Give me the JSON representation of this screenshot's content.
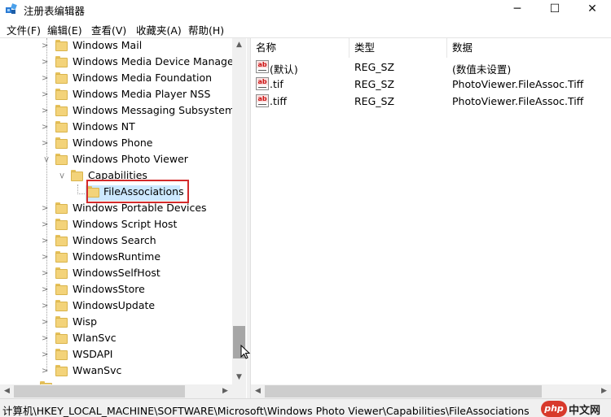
{
  "window": {
    "title": "注册表编辑器",
    "controls": {
      "minimize": "─",
      "maximize": "☐",
      "close": "✕"
    }
  },
  "menu": [
    "文件(F)",
    "编辑(E)",
    "查看(V)",
    "收藏夹(A)",
    "帮助(H)"
  ],
  "tree": {
    "items": [
      {
        "label": "Windows Mail",
        "expanded": false
      },
      {
        "label": "Windows Media Device Manager",
        "expanded": false
      },
      {
        "label": "Windows Media Foundation",
        "expanded": false
      },
      {
        "label": "Windows Media Player NSS",
        "expanded": false
      },
      {
        "label": "Windows Messaging Subsystem",
        "expanded": false
      },
      {
        "label": "Windows NT",
        "expanded": false
      },
      {
        "label": "Windows Phone",
        "expanded": false
      },
      {
        "label": "Windows Photo Viewer",
        "expanded": true
      },
      {
        "label": "Capabilities",
        "expanded": true
      },
      {
        "label": "FileAssociations",
        "selected": true
      },
      {
        "label": "Windows Portable Devices",
        "expanded": false
      },
      {
        "label": "Windows Script Host",
        "expanded": false
      },
      {
        "label": "Windows Search",
        "expanded": false
      },
      {
        "label": "WindowsRuntime",
        "expanded": false
      },
      {
        "label": "WindowsSelfHost",
        "expanded": false
      },
      {
        "label": "WindowsStore",
        "expanded": false
      },
      {
        "label": "WindowsUpdate",
        "expanded": false
      },
      {
        "label": "Wisp",
        "expanded": false
      },
      {
        "label": "WlanSvc",
        "expanded": false
      },
      {
        "label": "WSDAPI",
        "expanded": false
      },
      {
        "label": "WwanSvc",
        "expanded": false
      }
    ]
  },
  "list": {
    "columns": [
      "名称",
      "类型",
      "数据"
    ],
    "rows": [
      {
        "name": "(默认)",
        "type": "REG_SZ",
        "data": "(数值未设置)"
      },
      {
        "name": ".tif",
        "type": "REG_SZ",
        "data": "PhotoViewer.FileAssoc.Tiff"
      },
      {
        "name": ".tiff",
        "type": "REG_SZ",
        "data": "PhotoViewer.FileAssoc.Tiff"
      }
    ]
  },
  "status": {
    "path": "计算机\\HKEY_LOCAL_MACHINE\\SOFTWARE\\Microsoft\\Windows Photo Viewer\\Capabilities\\FileAssociations"
  },
  "watermark": {
    "badge": "php",
    "text": "中文网"
  },
  "colors": {
    "selection": "#cce8ff",
    "highlight_box": "#d42a2a",
    "folder": "#f3d37a"
  }
}
